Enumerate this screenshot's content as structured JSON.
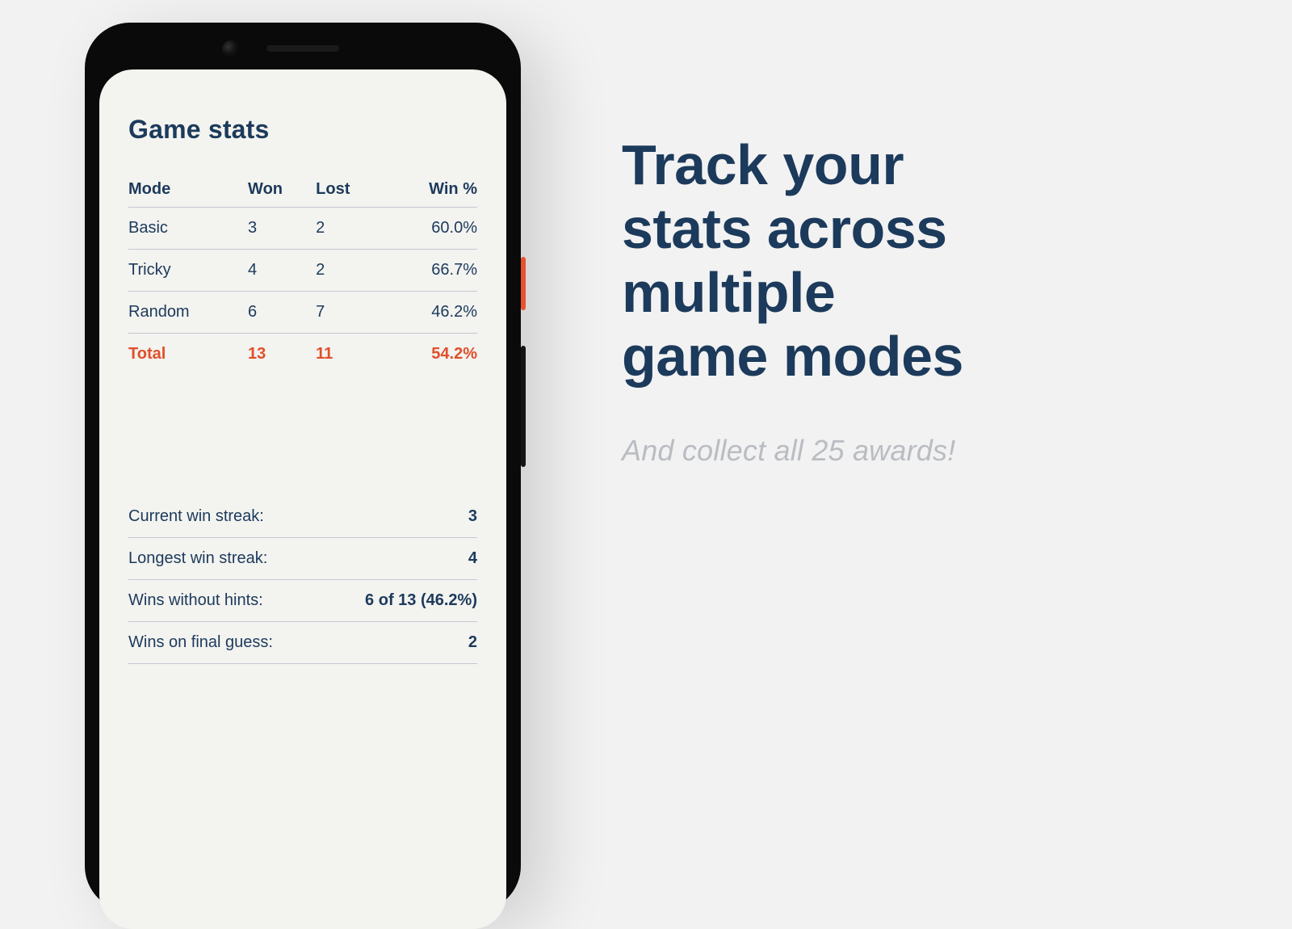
{
  "phone": {
    "title": "Game stats",
    "table": {
      "headers": {
        "mode": "Mode",
        "won": "Won",
        "lost": "Lost",
        "winpct": "Win %"
      },
      "rows": [
        {
          "mode": "Basic",
          "won": "3",
          "lost": "2",
          "winpct": "60.0%"
        },
        {
          "mode": "Tricky",
          "won": "4",
          "lost": "2",
          "winpct": "66.7%"
        },
        {
          "mode": "Random",
          "won": "6",
          "lost": "7",
          "winpct": "46.2%"
        }
      ],
      "total": {
        "mode": "Total",
        "won": "13",
        "lost": "11",
        "winpct": "54.2%"
      }
    },
    "extras": [
      {
        "label": "Current win streak:",
        "value": "3"
      },
      {
        "label": "Longest win streak:",
        "value": "4"
      },
      {
        "label": "Wins without hints:",
        "value": "6 of 13 (46.2%)"
      },
      {
        "label": "Wins on final guess:",
        "value": "2"
      }
    ]
  },
  "headline": {
    "line1": "Track your",
    "line2": "stats  across",
    "line3": "multiple",
    "line4": "game modes"
  },
  "subhead": "And collect all 25 awards!"
}
